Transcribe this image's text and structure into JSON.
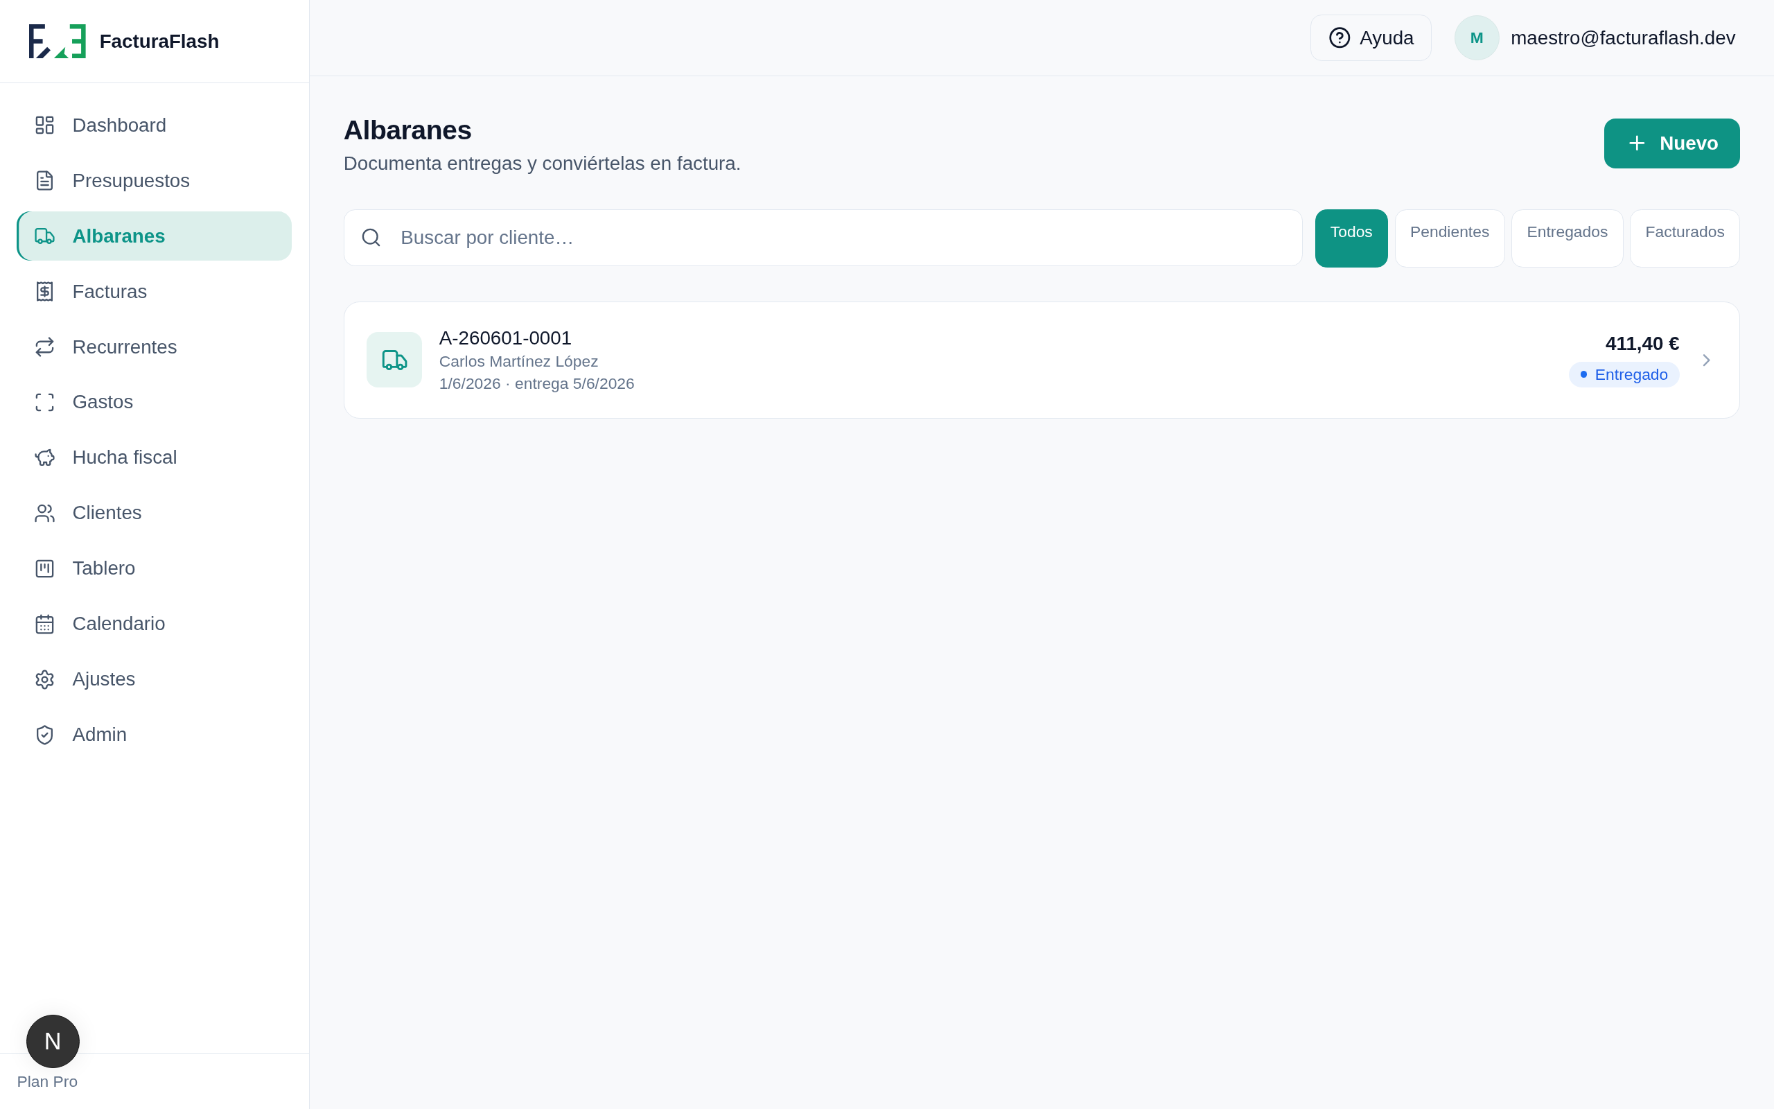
{
  "app": {
    "name": "FacturaFlash"
  },
  "sidebar": {
    "items": [
      {
        "label": "Dashboard",
        "selected": false
      },
      {
        "label": "Presupuestos",
        "selected": false
      },
      {
        "label": "Albaranes",
        "selected": true
      },
      {
        "label": "Facturas",
        "selected": false
      },
      {
        "label": "Recurrentes",
        "selected": false
      },
      {
        "label": "Gastos",
        "selected": false
      },
      {
        "label": "Hucha fiscal",
        "selected": false
      },
      {
        "label": "Clientes",
        "selected": false
      },
      {
        "label": "Tablero",
        "selected": false
      },
      {
        "label": "Calendario",
        "selected": false
      },
      {
        "label": "Ajustes",
        "selected": false
      },
      {
        "label": "Admin",
        "selected": false
      }
    ],
    "footer": "Plan Pro"
  },
  "header": {
    "help_button": "Ayuda",
    "user": {
      "initial": "M",
      "email": "maestro@facturaflash.dev"
    }
  },
  "page": {
    "title": "Albaranes",
    "subtitle": "Documenta entregas y conviértelas en factura.",
    "new_button": "Nuevo"
  },
  "search": {
    "placeholder": "Buscar por cliente…"
  },
  "filters": [
    {
      "label": "Todos",
      "selected": true
    },
    {
      "label": "Pendientes",
      "selected": false
    },
    {
      "label": "Entregados",
      "selected": false
    },
    {
      "label": "Facturados",
      "selected": false
    }
  ],
  "delivery_notes": [
    {
      "number": "A-260601-0001",
      "client": "Carlos Martínez López",
      "dates": "1/6/2026 · entrega 5/6/2026",
      "amount": "411,40 €",
      "status": "Entregado"
    }
  ],
  "dev_badge": {
    "letter": "N"
  }
}
